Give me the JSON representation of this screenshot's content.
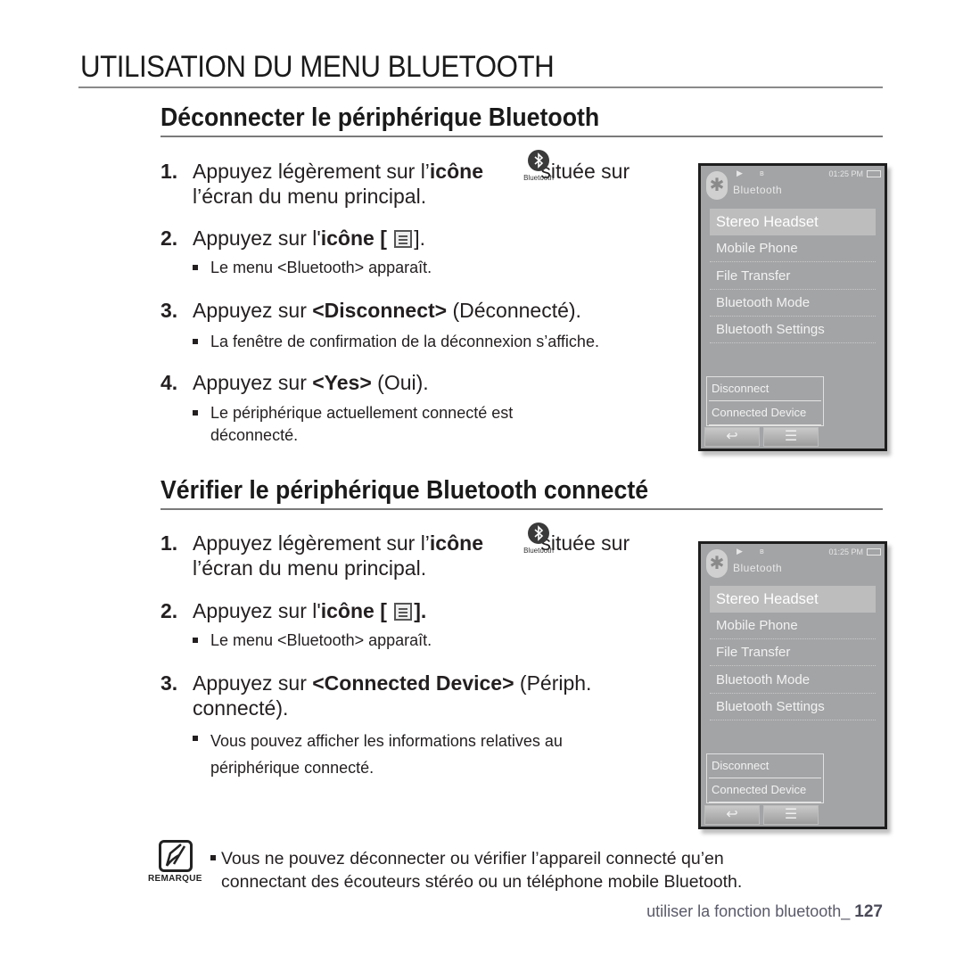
{
  "page": {
    "title": "UTILISATION DU MENU BLUETOOTH",
    "footer_text": "utiliser la fonction bluetooth_ ",
    "page_number": "127"
  },
  "sections": [
    {
      "title": "Déconnecter le périphérique Bluetooth",
      "steps": [
        {
          "num": "1.",
          "pre": "Appuyez légèrement sur l’",
          "bold": "icône",
          "post": "située sur",
          "cont": "l’écran du menu principal.",
          "icon_label": "Bluetooth"
        },
        {
          "num": "2.",
          "pre": "Appuyez sur l'",
          "bold": "icône [",
          "post_bold": "].",
          "bullet": "Le menu <Bluetooth> apparaît."
        },
        {
          "num": "3.",
          "pre": "Appuyez sur ",
          "bold": "<Disconnect>",
          "post": " (Déconnecté).",
          "bullet": "La fenêtre de confirmation de la déconnexion s’affiche."
        },
        {
          "num": "4.",
          "pre": "Appuyez sur ",
          "bold": "<Yes>",
          "post": " (Oui).",
          "bullet_l1": "Le périphérique actuellement connecté est",
          "bullet_l2": "déconnecté."
        }
      ]
    },
    {
      "title": "Vérifier le périphérique Bluetooth connecté",
      "steps": [
        {
          "num": "1.",
          "pre": "Appuyez légèrement sur l’",
          "bold": "icône",
          "post": "située sur",
          "cont": "l’écran du menu principal.",
          "icon_label": "Bluetooth"
        },
        {
          "num": "2.",
          "pre": "Appuyez sur l'",
          "bold": "icône [",
          "post_bold": "].",
          "bullet": "Le menu <Bluetooth> apparaît."
        },
        {
          "num": "3.",
          "pre": "Appuyez sur ",
          "bold": "<Connected Device>",
          "post": " (Périph.",
          "cont": "connecté).",
          "bullet_l1": "Vous pouvez afficher les informations relatives au",
          "bullet_l2": "périphérique connecté."
        }
      ]
    }
  ],
  "device": {
    "time": "01:25 PM",
    "header": "Bluetooth",
    "menu_items": [
      "Stereo Headset",
      "Mobile Phone",
      "File Transfer",
      "Bluetooth Mode",
      "Bluetooth Settings"
    ],
    "selected_index": 0,
    "popup_items": [
      "Disconnect",
      "Connected Device"
    ],
    "back_icon": "↩",
    "menu_icon": "☰"
  },
  "note": {
    "label": "REMARQUE",
    "line1": "Vous ne pouvez déconnecter ou vérifier l’appareil connecté qu’en",
    "line2": "connectant des écouteurs stéréo ou un téléphone mobile Bluetooth."
  }
}
